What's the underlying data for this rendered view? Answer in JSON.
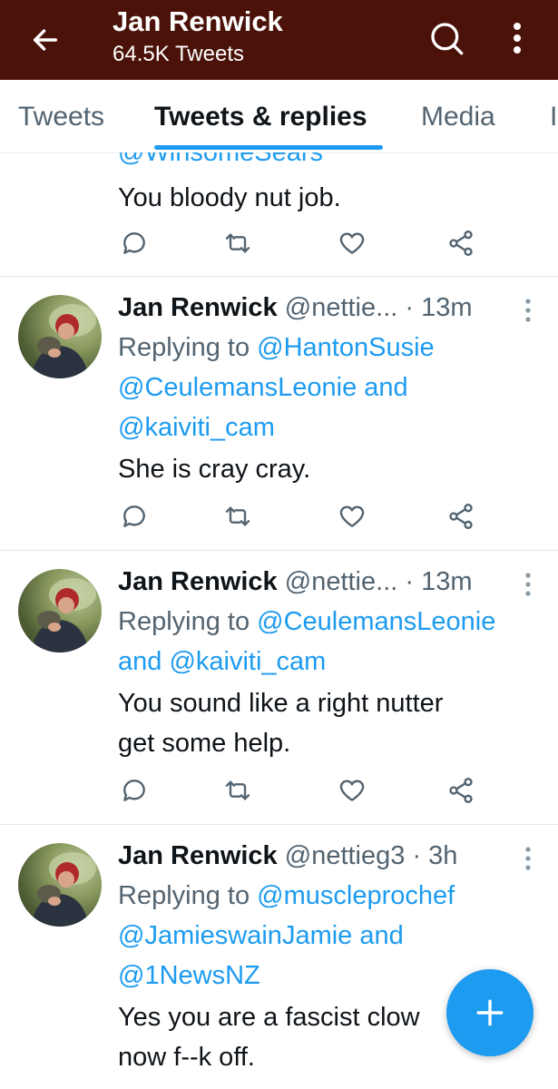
{
  "header": {
    "title": "Jan Renwick",
    "subtitle": "64.5K Tweets",
    "back_icon": "arrow-left-icon",
    "search_icon": "search-icon",
    "more_icon": "more-vertical-icon",
    "background_color": "#4a1208"
  },
  "tabs": [
    {
      "label": "Tweets",
      "active": false
    },
    {
      "label": "Tweets & replies",
      "active": true
    },
    {
      "label": "Media",
      "active": false
    }
  ],
  "partial_tweet": {
    "cutoff_mention": "@WinsomeSears",
    "text": "You bloody nut job."
  },
  "tweets": [
    {
      "name": "Jan Renwick",
      "handle": "@nettie...",
      "time": "· 13m",
      "reply_prefix": "Replying to ",
      "reply_lines": [
        [
          "@HantonSusie"
        ],
        [
          "@CeulemansLeonie",
          " and"
        ],
        [
          "@kaiviti_cam"
        ]
      ],
      "text_lines": [
        "She is cray cray."
      ]
    },
    {
      "name": "Jan Renwick",
      "handle": "@nettie...",
      "time": "· 13m",
      "reply_prefix": "Replying to ",
      "reply_lines": [
        [
          "@CeulemansLeonie"
        ],
        [
          "and ",
          "@kaiviti_cam"
        ]
      ],
      "text_lines": [
        "You sound like a right nutter",
        "get some help."
      ]
    },
    {
      "name": "Jan Renwick",
      "handle": "@nettieg3",
      "time": "· 3h",
      "reply_prefix": "Replying to ",
      "reply_lines": [
        [
          "@muscleprochef"
        ],
        [
          "@JamieswainJamie",
          " and"
        ],
        [
          "@1NewsNZ"
        ]
      ],
      "text_lines": [
        "Yes you are a fascist clow",
        "now f--k off."
      ]
    }
  ],
  "action_icons": [
    "reply-icon",
    "retweet-icon",
    "like-icon",
    "share-icon"
  ],
  "fab": {
    "icon": "compose-plus-icon",
    "color": "#1d9bf0"
  },
  "colors": {
    "accent": "#1d9bf0",
    "muted": "#536471",
    "text": "#0f1419"
  }
}
